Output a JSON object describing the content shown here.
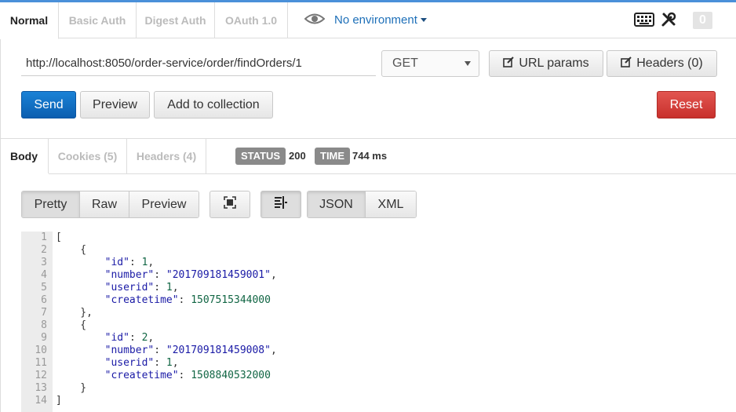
{
  "request_tabs": [
    "Normal",
    "Basic Auth",
    "Digest Auth",
    "OAuth 1.0"
  ],
  "environment": "No environment",
  "badge_count": "0",
  "url": "http://localhost:8050/order-service/order/findOrders/1",
  "method": "GET",
  "buttons": {
    "url_params": "URL params",
    "headers": "Headers (0)",
    "send": "Send",
    "preview": "Preview",
    "add_to_collection": "Add to collection",
    "reset": "Reset"
  },
  "response_tabs": [
    "Body",
    "Cookies (5)",
    "Headers (4)"
  ],
  "status": {
    "label": "STATUS",
    "value": "200"
  },
  "time": {
    "label": "TIME",
    "value": "744 ms"
  },
  "view_modes": [
    "Pretty",
    "Raw",
    "Preview"
  ],
  "formats": [
    "JSON",
    "XML"
  ],
  "code": {
    "line_numbers": [
      "1",
      "2",
      "3",
      "4",
      "5",
      "6",
      "7",
      "8",
      "9",
      "10",
      "11",
      "12",
      "13",
      "14"
    ],
    "orders": [
      {
        "id": "1",
        "number": "\"201709181459001\"",
        "userid": "1",
        "createtime": "1507515344000"
      },
      {
        "id": "2",
        "number": "\"201709181459008\"",
        "userid": "1",
        "createtime": "1508840532000"
      }
    ],
    "keys": {
      "id": "\"id\"",
      "number": "\"number\"",
      "userid": "\"userid\"",
      "createtime": "\"createtime\""
    }
  },
  "colors": {
    "accent": "#1d6fb8",
    "send": "#0b5eb0",
    "reset": "#c8302c",
    "pill": "#8a8a8a"
  }
}
